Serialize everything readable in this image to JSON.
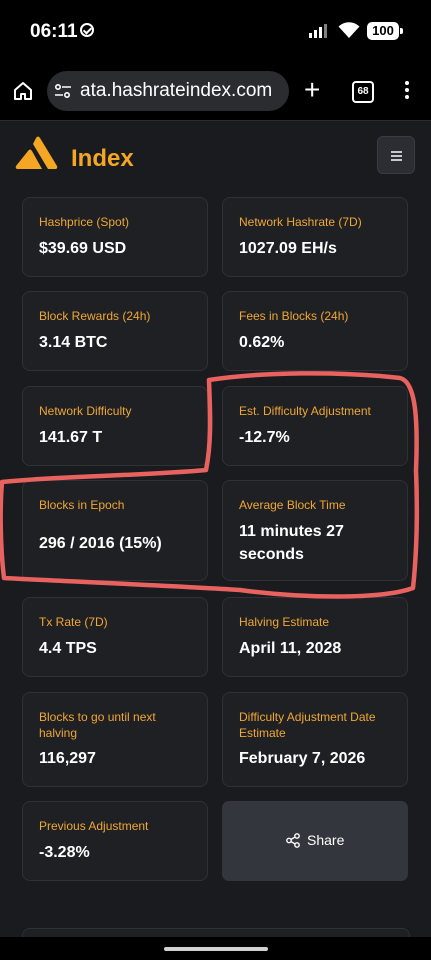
{
  "status_bar": {
    "time": "06:11",
    "battery": "100"
  },
  "browser": {
    "url": "ata.hashrateindex.com",
    "tab_count": "68"
  },
  "site": {
    "brand": "Index",
    "brand_color": "#f5a623"
  },
  "stats": [
    {
      "label": "Hashprice (Spot)",
      "value": "$39.69 USD"
    },
    {
      "label": "Network Hashrate (7D)",
      "value": "1027.09 EH/s"
    },
    {
      "label": "Block Rewards (24h)",
      "value": "3.14 BTC"
    },
    {
      "label": "Fees in Blocks (24h)",
      "value": "0.62%"
    },
    {
      "label": "Network Difficulty",
      "value": "141.67 T"
    },
    {
      "label": "Est. Difficulty Adjustment",
      "value": "-12.7%"
    },
    {
      "label": "Blocks in Epoch",
      "value": "296 / 2016 (15%)"
    },
    {
      "label": "Average Block Time",
      "value_line1": "11 minutes 27",
      "value_line2": "seconds"
    },
    {
      "label": "Tx Rate (7D)",
      "value": "4.4 TPS"
    },
    {
      "label": "Halving Estimate",
      "value": "April 11, 2028"
    },
    {
      "label_line1": "Blocks to go until next",
      "label_line2": "halving",
      "value": "116,297"
    },
    {
      "label_line1": "Difficulty Adjustment Date",
      "label_line2": "Estimate",
      "value": "February 7, 2026"
    },
    {
      "label": "Previous Adjustment",
      "value": "-3.28%"
    }
  ],
  "share_label": "Share",
  "annotation_color": "#e8625f"
}
